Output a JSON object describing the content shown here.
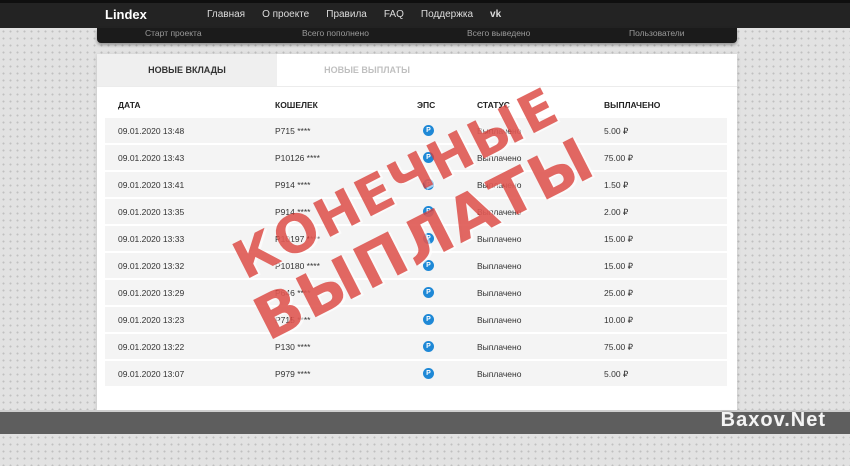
{
  "header": {
    "logo": "Lindex",
    "nav": [
      "Главная",
      "О проекте",
      "Правила",
      "FAQ",
      "Поддержка"
    ],
    "social_icon": "vk-icon",
    "social_text": "vk"
  },
  "stats": [
    "Старт проекта",
    "Всего пополнено",
    "Всего выведено",
    "Пользователи"
  ],
  "tabs": {
    "active": "НОВЫЕ ВКЛАДЫ",
    "inactive": "НОВЫЕ ВЫПЛАТЫ"
  },
  "table": {
    "headers": [
      "ДАТА",
      "КОШЕЛЕК",
      "ЭПС",
      "СТАТУС",
      "ВЫПЛАЧЕНО"
    ],
    "eps_icon": "payeer-icon",
    "eps_letter": "P",
    "rows": [
      [
        "09.01.2020 13:48",
        "P715 ****",
        "Выплачено",
        "5.00 ₽"
      ],
      [
        "09.01.2020 13:43",
        "P10126 ****",
        "Выплачено",
        "75.00 ₽"
      ],
      [
        "09.01.2020 13:41",
        "P914 ****",
        "Выплачено",
        "1.50 ₽"
      ],
      [
        "09.01.2020 13:35",
        "P914 ****",
        "Выплачено",
        "2.00 ₽"
      ],
      [
        "09.01.2020 13:33",
        "P10197 ****",
        "Выплачено",
        "15.00 ₽"
      ],
      [
        "09.01.2020 13:32",
        "P10180 ****",
        "Выплачено",
        "15.00 ₽"
      ],
      [
        "09.01.2020 13:29",
        "P646 ****",
        "Выплачено",
        "25.00 ₽"
      ],
      [
        "09.01.2020 13:23",
        "P715 ****",
        "Выплачено",
        "10.00 ₽"
      ],
      [
        "09.01.2020 13:22",
        "P130 ****",
        "Выплачено",
        "75.00 ₽"
      ],
      [
        "09.01.2020 13:07",
        "P979 ****",
        "Выплачено",
        "5.00 ₽"
      ]
    ]
  },
  "stamp": {
    "line1": "КОНЕЧНЫЕ",
    "line2": "ВЫПЛАТЫ"
  },
  "watermark": "Baxov.Net",
  "colors": {
    "stamp": "#da3e37",
    "eps_icon": "#1e88d6",
    "topbar": "#232323"
  }
}
